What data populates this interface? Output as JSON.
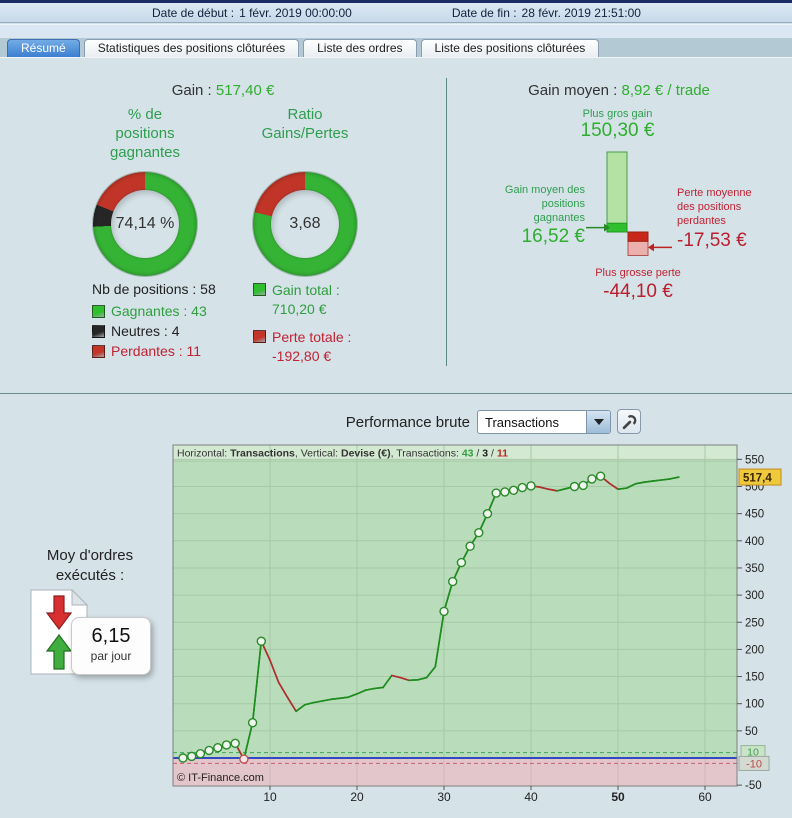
{
  "header": {
    "date_start_label": "Date de début :",
    "date_start_value": "1 févr. 2019 00:00:00",
    "date_end_label": "Date de fin :",
    "date_end_value": "28 févr. 2019 21:51:00"
  },
  "tabs": [
    {
      "label": "Résumé",
      "active": true
    },
    {
      "label": "Statistiques des positions clôturées",
      "active": false
    },
    {
      "label": "Liste des ordres",
      "active": false
    },
    {
      "label": "Liste des positions clôturées",
      "active": false
    }
  ],
  "summary": {
    "gain_label": "Gain :",
    "gain_value": "517,40 €",
    "winrate": {
      "title": [
        "% de",
        "positions",
        "gagnantes"
      ],
      "center": "74,14 %",
      "wins": 43,
      "neutrals": 4,
      "losses": 11
    },
    "ratio": {
      "title": [
        "Ratio",
        "Gains/Pertes"
      ],
      "center": "3,68",
      "ratio_value": 3.68
    },
    "legend": {
      "total_label": "Nb de positions : 58",
      "items": [
        {
          "label": "Gagnantes : 43",
          "color": "#2ebe2e"
        },
        {
          "label": "Neutres : 4",
          "color": "#262626"
        },
        {
          "label": "Perdantes : 11",
          "color": "#c23527"
        }
      ],
      "gain_total_label": "Gain total :",
      "gain_total_value": "710,20 €",
      "perte_totale_label": "Perte totale :",
      "perte_totale_value": "-192,80 €"
    }
  },
  "average": {
    "title_label": "Gain moyen :",
    "title_value": "8,92 € / trade",
    "biggest_gain_label": "Plus gros gain",
    "biggest_gain_value": "150,30 €",
    "avg_win_label": [
      "Gain moyen des",
      "positions",
      "gagnantes"
    ],
    "avg_win_value": "16,52 €",
    "avg_loss_label": [
      "Perte moyenne",
      "des positions",
      "perdantes"
    ],
    "avg_loss_value": "-17,53 €",
    "biggest_loss_label": "Plus grosse perte",
    "biggest_loss_value": "-44,10 €",
    "numbers": {
      "biggest_gain": 150.3,
      "avg_win": 16.52,
      "avg_loss": 17.53,
      "biggest_loss": 44.1
    }
  },
  "performance": {
    "title": "Performance brute",
    "dropdown_value": "Transactions",
    "avg_orders_label": [
      "Moy d'ordres",
      "exécutés :"
    ],
    "avg_orders_value": "6,15",
    "avg_orders_unit": "par jour"
  },
  "chart_data": {
    "type": "line",
    "title": "Performance brute",
    "x_axis": "Transactions",
    "y_axis": "Devise (€)",
    "x": [
      0,
      1,
      2,
      3,
      4,
      5,
      6,
      7,
      8,
      9,
      10,
      11,
      12,
      13,
      14,
      15,
      16,
      17,
      18,
      19,
      20,
      21,
      22,
      23,
      24,
      25,
      26,
      27,
      28,
      29,
      30,
      31,
      32,
      33,
      34,
      35,
      36,
      37,
      38,
      39,
      40,
      41,
      42,
      43,
      44,
      45,
      46,
      47,
      48,
      49,
      50,
      51,
      52,
      53,
      54,
      55,
      56,
      57
    ],
    "values": [
      0,
      3,
      8,
      14,
      19,
      24,
      27,
      -2,
      65,
      215,
      180,
      139,
      112,
      86,
      98,
      102,
      105,
      108,
      110,
      112,
      118,
      125,
      128,
      130,
      152,
      148,
      143,
      144,
      148,
      168,
      270,
      325,
      360,
      390,
      415,
      450,
      488,
      490,
      493,
      498,
      501,
      499,
      495,
      492,
      496,
      500,
      502,
      514,
      519,
      506,
      495,
      497,
      505,
      508,
      510,
      512,
      514,
      517.4
    ],
    "markers": [
      0,
      1,
      2,
      3,
      4,
      5,
      6,
      8,
      9,
      30,
      31,
      32,
      33,
      34,
      35,
      36,
      37,
      38,
      39,
      40,
      45,
      46,
      47,
      48
    ],
    "loss_markers": [
      7
    ],
    "red_segments": [
      [
        6,
        7
      ],
      [
        9,
        13
      ],
      [
        24,
        26
      ],
      [
        40,
        43
      ],
      [
        48,
        50
      ]
    ],
    "xticks": [
      10,
      20,
      30,
      40,
      50,
      60
    ],
    "bold_xtick": 50,
    "yticks": [
      550,
      500,
      450,
      400,
      350,
      300,
      250,
      200,
      150,
      100,
      50,
      -50
    ],
    "xlim": [
      -1.1,
      63.7
    ],
    "ylim": [
      -51.6,
      576.4
    ],
    "hlines": [
      {
        "v": 10,
        "style": "dashed",
        "color": "#3aa85a"
      },
      {
        "v": 0,
        "style": "solid",
        "color": "#3448c0"
      },
      {
        "v": -10,
        "style": "dashed",
        "color": "#c86070"
      }
    ],
    "last_value_label": "517,4",
    "badge_up_label": "10",
    "badge_down_label": "-10",
    "legend_parts": [
      {
        "t": "Horizontal: "
      },
      {
        "t": "Transactions",
        "b": true
      },
      {
        "t": ", Vertical: "
      },
      {
        "t": "Devise (€)",
        "b": true
      },
      {
        "t": ", Transactions: "
      },
      {
        "t": "43",
        "b": true,
        "c": "#2e9e3e"
      },
      {
        "t": " / "
      },
      {
        "t": "3",
        "b": true,
        "c": "#222222"
      },
      {
        "t": " / "
      },
      {
        "t": "11",
        "b": true,
        "c": "#c22222"
      }
    ],
    "watermark": "© IT-Finance.com",
    "colors": {
      "line": "#1e8c1e",
      "loss": "#b03030",
      "bg_positive": "#b9dcba",
      "bg_negative": "#e3c5cc",
      "grid": "#a6c9a6",
      "grid_neg": "#d2b8bf",
      "marker_fill": "#eef6ee",
      "badge_last_bg": "#efc93c"
    }
  },
  "colors": {
    "green_text": "#2e9e4e",
    "green_value": "#2fae2f",
    "red_text": "#c22233",
    "red_value": "#bb1f2e",
    "donut_win": "#35b335",
    "donut_neutral": "#262626",
    "donut_loss": "#c03527",
    "active_tab": "#3c7fd0",
    "bar_green_body": "#b4e2a4",
    "bar_green_band": "#2fbf2f",
    "bar_red_band": "#c8281a",
    "bar_red_body": "#ecb0ac"
  }
}
